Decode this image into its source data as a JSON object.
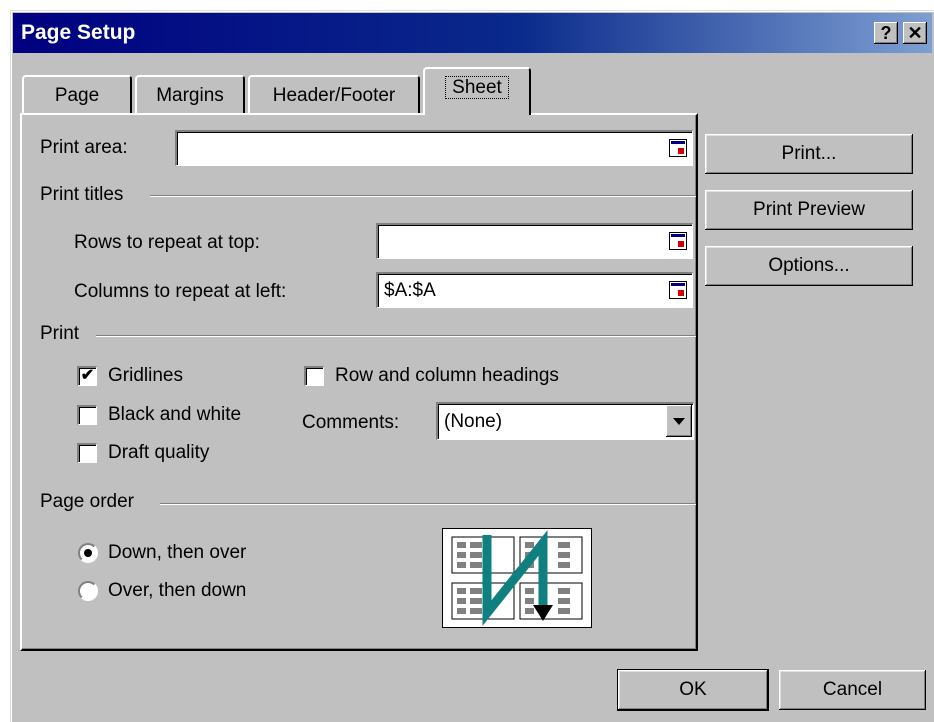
{
  "window": {
    "title": "Page Setup",
    "help_glyph": "?",
    "close_glyph": "✕"
  },
  "tabs": [
    {
      "label": "Page"
    },
    {
      "label": "Margins"
    },
    {
      "label": "Header/Footer"
    },
    {
      "label": "Sheet",
      "active": true
    }
  ],
  "print_area": {
    "label": "Print area:",
    "value": ""
  },
  "print_titles": {
    "heading": "Print titles",
    "rows": {
      "label": "Rows to repeat at top:",
      "value": ""
    },
    "columns": {
      "label": "Columns to repeat at left:",
      "value": "$A:$A"
    }
  },
  "print_section": {
    "heading": "Print",
    "gridlines": {
      "label": "Gridlines",
      "checked": true
    },
    "black_white": {
      "label": "Black and white",
      "checked": false
    },
    "draft": {
      "label": "Draft quality",
      "checked": false
    },
    "row_col_headings": {
      "label": "Row and column headings",
      "checked": false
    },
    "comments": {
      "label": "Comments:",
      "value": "(None)"
    }
  },
  "page_order": {
    "heading": "Page order",
    "down_over": {
      "label": "Down, then over",
      "selected": true
    },
    "over_down": {
      "label": "Over, then down",
      "selected": false
    }
  },
  "buttons": {
    "print": "Print...",
    "preview": "Print Preview",
    "options": "Options...",
    "ok": "OK",
    "cancel": "Cancel"
  },
  "colors": {
    "title_start": "#000080",
    "title_end": "#7e9fd2",
    "face": "#c0c0c0",
    "arrow": "#0f7f80"
  },
  "check_glyph": "✔"
}
